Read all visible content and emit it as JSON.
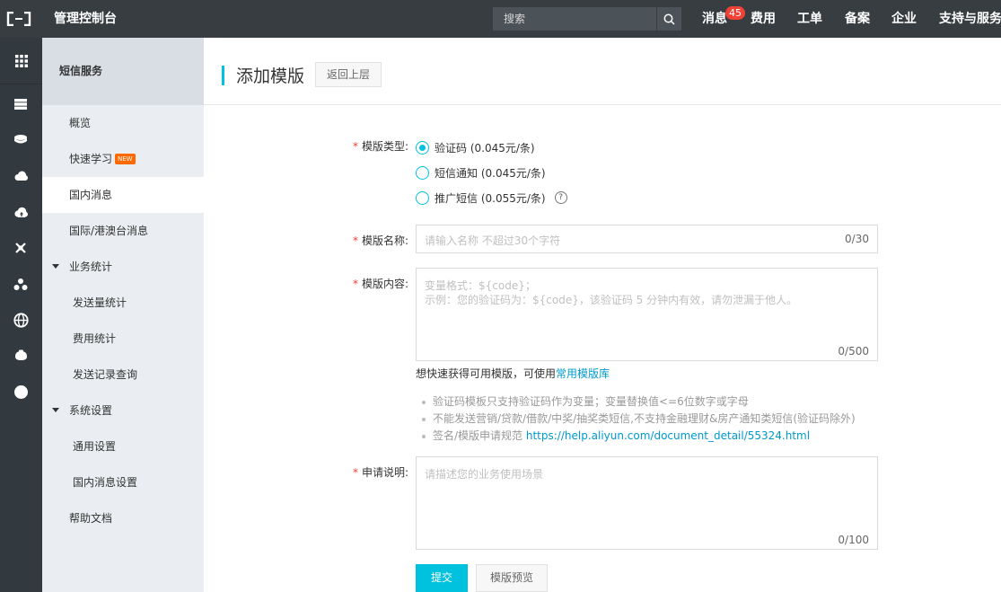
{
  "topbar": {
    "logo_icon": "aliyun-logo-icon",
    "app_title": "管理控制台",
    "search_placeholder": "搜索",
    "search_icon": "search-icon",
    "nav": {
      "messages": "消息",
      "messages_badge": "45",
      "billing": "费用",
      "tickets": "工单",
      "filing": "备案",
      "enterprise": "企业",
      "support": "支持与服务"
    }
  },
  "rail": {
    "icons": [
      "grid-icon",
      "server-icon",
      "database-icon",
      "cloud-icon",
      "cloud-upload-icon",
      "network-icon",
      "cluster-icon",
      "globe-icon",
      "shell-icon",
      "circle-icon"
    ]
  },
  "sidebar": {
    "header": "短信服务",
    "items": [
      {
        "label": "概览"
      },
      {
        "label": "快速学习",
        "tag": "NEW"
      },
      {
        "label": "国内消息",
        "active": true
      },
      {
        "label": "国际/港澳台消息"
      },
      {
        "label": "业务统计",
        "group": true
      },
      {
        "label": "发送量统计"
      },
      {
        "label": "费用统计"
      },
      {
        "label": "发送记录查询"
      },
      {
        "label": "系统设置",
        "group": true
      },
      {
        "label": "通用设置"
      },
      {
        "label": "国内消息设置"
      },
      {
        "label": "帮助文档"
      }
    ]
  },
  "page": {
    "title": "添加模版",
    "back_label": "返回上层"
  },
  "form": {
    "type": {
      "label": "模版类型:",
      "options": [
        {
          "label": "验证码 (0.045元/条)",
          "checked": true
        },
        {
          "label": "短信通知 (0.045元/条)",
          "checked": false
        },
        {
          "label": "推广短信 (0.055元/条)",
          "checked": false
        }
      ],
      "help_glyph": "?"
    },
    "name": {
      "label": "模版名称:",
      "placeholder": "请输入名称 不超过30个字符",
      "counter": "0/30"
    },
    "content": {
      "label": "模版内容:",
      "placeholder_line1": "变量格式：${code}；",
      "placeholder_line2": "示例：您的验证码为：${code}，该验证码 5 分钟内有效，请勿泄漏于他人。",
      "counter": "0/500",
      "hint_text": "想快速获得可用模版，可使用",
      "hint_link": "常用模版库"
    },
    "rules": {
      "rule1": "验证码模板只支持验证码作为变量；变量替换值<=6位数字或字母",
      "rule2": "不能发送营销/贷款/借款/中奖/抽奖类短信,不支持金融理财&房产通知类短信(验证码除外)",
      "rule3_text": "签名/模版申请规范 ",
      "rule3_link": "https://help.aliyun.com/document_detail/55324.html"
    },
    "desc": {
      "label": "申请说明:",
      "placeholder": "请描述您的业务使用场景",
      "counter": "0/100"
    },
    "submit_label": "提交",
    "preview_label": "模版预览"
  },
  "colors": {
    "accent": "#00c1de",
    "topbar": "#373d41",
    "rail": "#333a3f",
    "sidebar": "#eaedf1",
    "badge": "#f04134",
    "new_tag": "#ff6a00",
    "link": "#0099cc"
  }
}
